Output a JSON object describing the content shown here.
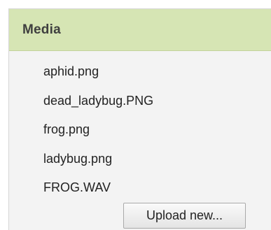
{
  "media_panel": {
    "title": "Media",
    "files": [
      "aphid.png",
      "dead_ladybug.PNG",
      "frog.png",
      "ladybug.png",
      "FROG.WAV"
    ],
    "upload_label": "Upload new..."
  }
}
